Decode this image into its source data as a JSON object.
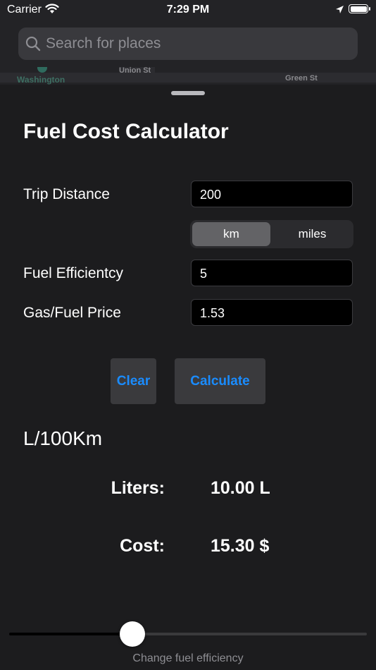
{
  "status_bar": {
    "carrier": "Carrier",
    "time": "7:29 PM"
  },
  "map": {
    "labels": [
      "Washington",
      "Union St",
      "Green St"
    ]
  },
  "search": {
    "placeholder": "Search for places"
  },
  "calculator": {
    "title": "Fuel Cost Calculator",
    "trip_distance_label": "Trip Distance",
    "trip_distance_value": "200",
    "distance_units": [
      "km",
      "miles"
    ],
    "selected_unit": "km",
    "fuel_efficiency_label": "Fuel Efficientcy",
    "fuel_efficiency_value": "5",
    "price_label": "Gas/Fuel Price",
    "price_value": "1.53",
    "clear_label": "Clear",
    "calculate_label": "Calculate",
    "efficiency_unit": "L/100Km",
    "liters_label": "Liters:",
    "liters_value": "10.00 L",
    "cost_label": "Cost:",
    "cost_value": "15.30 $"
  },
  "slider": {
    "caption": "Change fuel efficiency",
    "value_fraction": 0.34
  },
  "colors": {
    "accent": "#1a8cff",
    "background": "#1c1c1e",
    "field": "#000000"
  }
}
